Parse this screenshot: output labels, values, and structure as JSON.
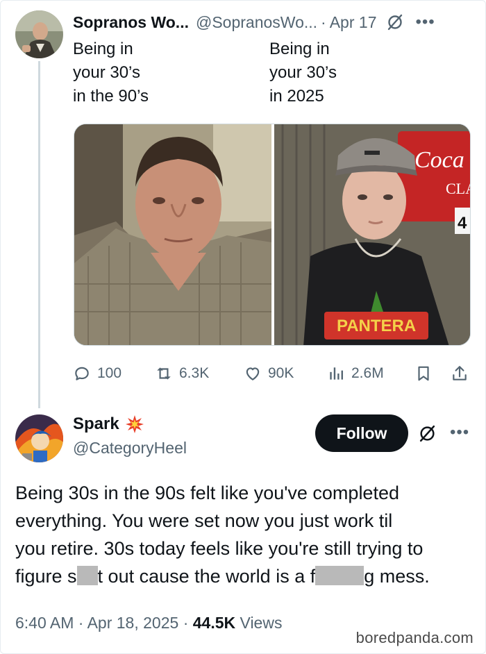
{
  "colors": {
    "text_primary": "#0f1419",
    "text_secondary": "#536471",
    "thread_line": "#cfd9de",
    "follow_bg": "#0f1419",
    "redaction": "#b9b9b9"
  },
  "tweet": {
    "author_name": "Sopranos Wo...",
    "author_handle": "@SopranosWo...",
    "separator": "·",
    "date": "Apr 17",
    "more_icon": "more-horizontal-icon",
    "grok_icon": "grok-slash-icon",
    "caption_left": "Being in\nyour 30’s\nin the 90’s",
    "caption_right": "Being in\nyour 30’s\nin 2025",
    "image_left_alt": "man in plaid shirt",
    "image_right_alt": "young man in cap and band t-shirt",
    "right_image_sign_text": "Coca",
    "right_image_sign_sub": "CLA",
    "right_image_sign_num": "4",
    "shirt_text": "PANTERA",
    "metrics": {
      "replies": "100",
      "reposts": "6.3K",
      "likes": "90K",
      "views": "2.6M"
    }
  },
  "reply": {
    "author_name": "Spark",
    "author_badge_icon": "spark-burst-icon",
    "author_handle": "@CategoryHeel",
    "follow_label": "Follow",
    "text_line1": "Being 30s in the 90s felt like you've completed",
    "text_line2": "everything. You were set now you just work til",
    "text_line3": "you retire. 30s today feels like you're still trying to",
    "text_line4_a": "figure s",
    "text_line4_b": "t out cause the world is a f",
    "text_line4_c": "g mess.",
    "time": "6:40 AM",
    "separator": "·",
    "date": "Apr 18, 2025",
    "views_count": "44.5K",
    "views_label": "Views"
  },
  "watermark": "boredpanda.com"
}
